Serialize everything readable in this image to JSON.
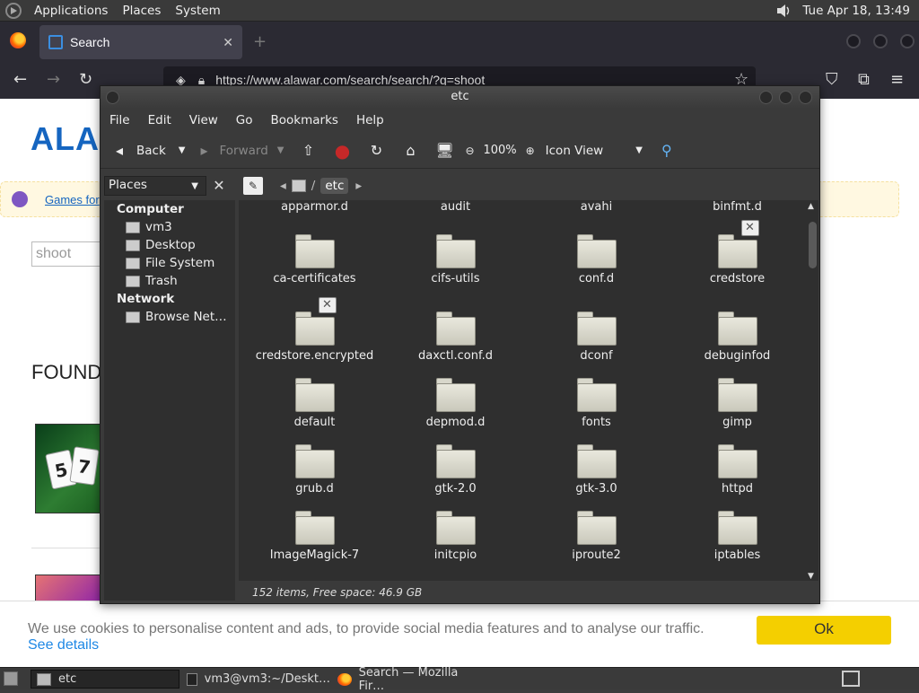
{
  "top_panel": {
    "menus": [
      "Applications",
      "Places",
      "System"
    ],
    "clock": "Tue Apr 18, 13:49"
  },
  "firefox": {
    "tab_title": "Search",
    "url": "https://www.alawar.com/search/search/?q=shoot"
  },
  "webpage": {
    "logo_text": "ALA",
    "games_link": "Games for",
    "search_value": "shoot",
    "found_heading": "FOUND",
    "thumb_cards": [
      "5",
      "7"
    ]
  },
  "cookie_bar": {
    "text": "We use cookies to personalise content and ads, to provide social media features and to analyse our traffic.",
    "details_link": "See details",
    "ok_button": "Ok"
  },
  "file_manager": {
    "title": "etc",
    "menus": [
      "File",
      "Edit",
      "View",
      "Go",
      "Bookmarks",
      "Help"
    ],
    "toolbar": {
      "back": "Back",
      "forward": "Forward",
      "zoom": "100%",
      "view_mode": "Icon View"
    },
    "sidebar_select": "Places",
    "breadcrumb": {
      "separator": "/",
      "current": "etc"
    },
    "sidebar": {
      "computer_heading": "Computer",
      "computer_items": [
        "vm3",
        "Desktop",
        "File System",
        "Trash"
      ],
      "network_heading": "Network",
      "network_items": [
        "Browse Net…"
      ]
    },
    "top_row": [
      "apparmor.d",
      "audit",
      "avahi",
      "binfmt.d"
    ],
    "folders": [
      {
        "name": "ca-certificates"
      },
      {
        "name": "cifs-utils"
      },
      {
        "name": "conf.d"
      },
      {
        "name": "credstore",
        "locked": true
      },
      {
        "name": "credstore.encrypted",
        "locked": true
      },
      {
        "name": "daxctl.conf.d"
      },
      {
        "name": "dconf"
      },
      {
        "name": "debuginfod"
      },
      {
        "name": "default"
      },
      {
        "name": "depmod.d"
      },
      {
        "name": "fonts"
      },
      {
        "name": "gimp"
      },
      {
        "name": "grub.d"
      },
      {
        "name": "gtk-2.0"
      },
      {
        "name": "gtk-3.0"
      },
      {
        "name": "httpd"
      },
      {
        "name": "ImageMagick-7"
      },
      {
        "name": "initcpio"
      },
      {
        "name": "iproute2"
      },
      {
        "name": "iptables"
      }
    ],
    "status": "152 items, Free space: 46.9 GB"
  },
  "taskbar": {
    "items": [
      "etc",
      "vm3@vm3:~/Deskt…",
      "Search — Mozilla Fir…"
    ]
  }
}
